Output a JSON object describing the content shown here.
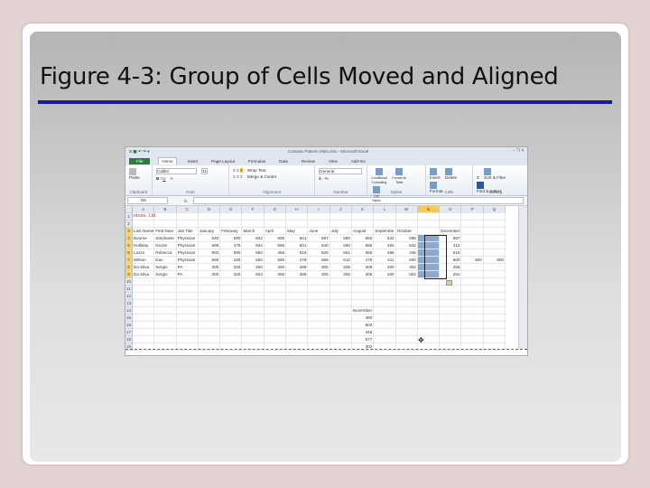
{
  "slide": {
    "title": "Figure 4-3: Group of Cells Moved and Aligned"
  },
  "excel": {
    "window_title": "Contoso Patient Visits.xlsx - Microsoft Excel",
    "tabs": [
      "File",
      "Home",
      "Insert",
      "Page Layout",
      "Formulas",
      "Data",
      "Review",
      "View",
      "Add-Ins"
    ],
    "ribbon": {
      "clipboard": {
        "label": "Clipboard",
        "paste": "Paste"
      },
      "font": {
        "label": "Font",
        "name": "Calibri",
        "size": "11"
      },
      "alignment": {
        "label": "Alignment",
        "wrap": "Wrap Text",
        "merge": "Merge & Center"
      },
      "number": {
        "label": "Number",
        "format": "General",
        "currency": "$ - %"
      },
      "styles": {
        "label": "Styles",
        "items": [
          "Conditional Formatting",
          "Format as Table",
          "Cell Styles"
        ]
      },
      "cells": {
        "label": "Cells",
        "items": [
          "Insert",
          "Delete",
          "Format"
        ]
      },
      "editing": {
        "label": "Editing",
        "items": [
          "Sort & Filter",
          "Find & Select"
        ]
      }
    },
    "name_box": "N5",
    "fx": "fx",
    "columns": [
      "A",
      "B",
      "C",
      "D",
      "E",
      "F",
      "G",
      "H",
      "I",
      "J",
      "K",
      "L",
      "M",
      "N",
      "O",
      "P",
      "Q"
    ],
    "selected_column": "N",
    "rows": [
      [
        "ntoso, Ltd.",
        "",
        "",
        "",
        "",
        "",
        "",
        "",
        "",
        "",
        "",
        "",
        "",
        "",
        "",
        "",
        ""
      ],
      [
        "",
        "",
        "",
        "",
        "",
        "",
        "",
        "",
        "",
        "",
        "",
        "",
        "",
        "",
        "",
        "",
        ""
      ],
      [
        "Last Name",
        "First Nam",
        "Job Title",
        "January",
        "February",
        "March",
        "April",
        "May",
        "June",
        "July",
        "August",
        "Septembe",
        "October",
        "",
        "December",
        "",
        ""
      ],
      [
        "Bourne",
        "Stephanie",
        "Physician",
        "640",
        "590",
        "602",
        "605",
        "601",
        "587",
        "580",
        "650",
        "532",
        "598",
        "",
        "567",
        "",
        ""
      ],
      [
        "Holliday",
        "Nicole",
        "Physician",
        "589",
        "475",
        "604",
        "595",
        "601",
        "640",
        "590",
        "595",
        "484",
        "642",
        "",
        "412",
        "",
        ""
      ],
      [
        "Lazzo",
        "Rebecca",
        "Physician",
        "903",
        "590",
        "550",
        "455",
        "515",
        "828",
        "651",
        "555",
        "486",
        "446",
        "",
        "515",
        "",
        ""
      ],
      [
        "Wilson",
        "Dan",
        "Physician",
        "565",
        "325",
        "550",
        "580",
        "478",
        "586",
        "612",
        "475",
        "611",
        "600",
        "",
        "600",
        "600",
        "600"
      ],
      [
        "Da Silva",
        "Sergio",
        "PA",
        "300",
        "325",
        "250",
        "300",
        "289",
        "305",
        "205",
        "305",
        "400",
        "302",
        "",
        "256",
        "",
        ""
      ],
      [
        "Da Silva",
        "Sergio",
        "PA",
        "300",
        "325",
        "604",
        "300",
        "289",
        "305",
        "255",
        "305",
        "400",
        "502",
        "",
        "254",
        "",
        ""
      ],
      [
        "",
        "",
        "",
        "",
        "",
        "",
        "",
        "",
        "",
        "",
        "",
        "",
        "",
        "",
        "",
        "",
        ""
      ],
      [
        "",
        "",
        "",
        "",
        "",
        "",
        "",
        "",
        "",
        "",
        "",
        "",
        "",
        "",
        "",
        "",
        ""
      ],
      [
        "",
        "",
        "",
        "",
        "",
        "",
        "",
        "",
        "",
        "",
        "",
        "",
        "",
        "",
        "",
        "",
        ""
      ],
      [
        "",
        "",
        "",
        "",
        "",
        "",
        "",
        "",
        "",
        "",
        "",
        "",
        "",
        "",
        "",
        "",
        ""
      ],
      [
        "",
        "",
        "",
        "",
        "",
        "",
        "",
        "",
        "",
        "",
        "November",
        "",
        "",
        "",
        "",
        "",
        ""
      ],
      [
        "",
        "",
        "",
        "",
        "",
        "",
        "",
        "",
        "",
        "",
        "480",
        "",
        "",
        "",
        "",
        "",
        ""
      ],
      [
        "",
        "",
        "",
        "",
        "",
        "",
        "",
        "",
        "",
        "",
        "502",
        "",
        "",
        "",
        "",
        "",
        ""
      ],
      [
        "",
        "",
        "",
        "",
        "",
        "",
        "",
        "",
        "",
        "",
        "446",
        "",
        "",
        "",
        "",
        "",
        ""
      ],
      [
        "",
        "",
        "",
        "",
        "",
        "",
        "",
        "",
        "",
        "",
        "577",
        "",
        "",
        "",
        "",
        "",
        ""
      ],
      [
        "",
        "",
        "",
        "",
        "",
        "",
        "",
        "",
        "",
        "",
        "302",
        "",
        "",
        "",
        "",
        "",
        ""
      ]
    ]
  }
}
